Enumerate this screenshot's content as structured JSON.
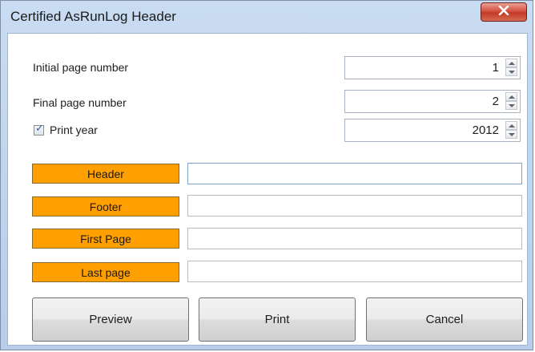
{
  "window": {
    "title": "Certified AsRunLog Header",
    "close_icon": "close-icon"
  },
  "fields": {
    "initial_page": {
      "label": "Initial page number",
      "value": "1"
    },
    "final_page": {
      "label": "Final page number",
      "value": "2"
    },
    "print_year": {
      "label": "Print year",
      "checked": true,
      "value": "2012"
    }
  },
  "sections": {
    "header": {
      "label": "Header",
      "value": ""
    },
    "footer": {
      "label": "Footer",
      "value": ""
    },
    "first_page": {
      "label": "First Page",
      "value": ""
    },
    "last_page": {
      "label": "Last page",
      "value": ""
    }
  },
  "buttons": {
    "preview": "Preview",
    "print": "Print",
    "cancel": "Cancel"
  },
  "colors": {
    "tag_orange": "#ff9f00",
    "close_red": "#c23a27",
    "frame_blue": "#b7cde9"
  }
}
